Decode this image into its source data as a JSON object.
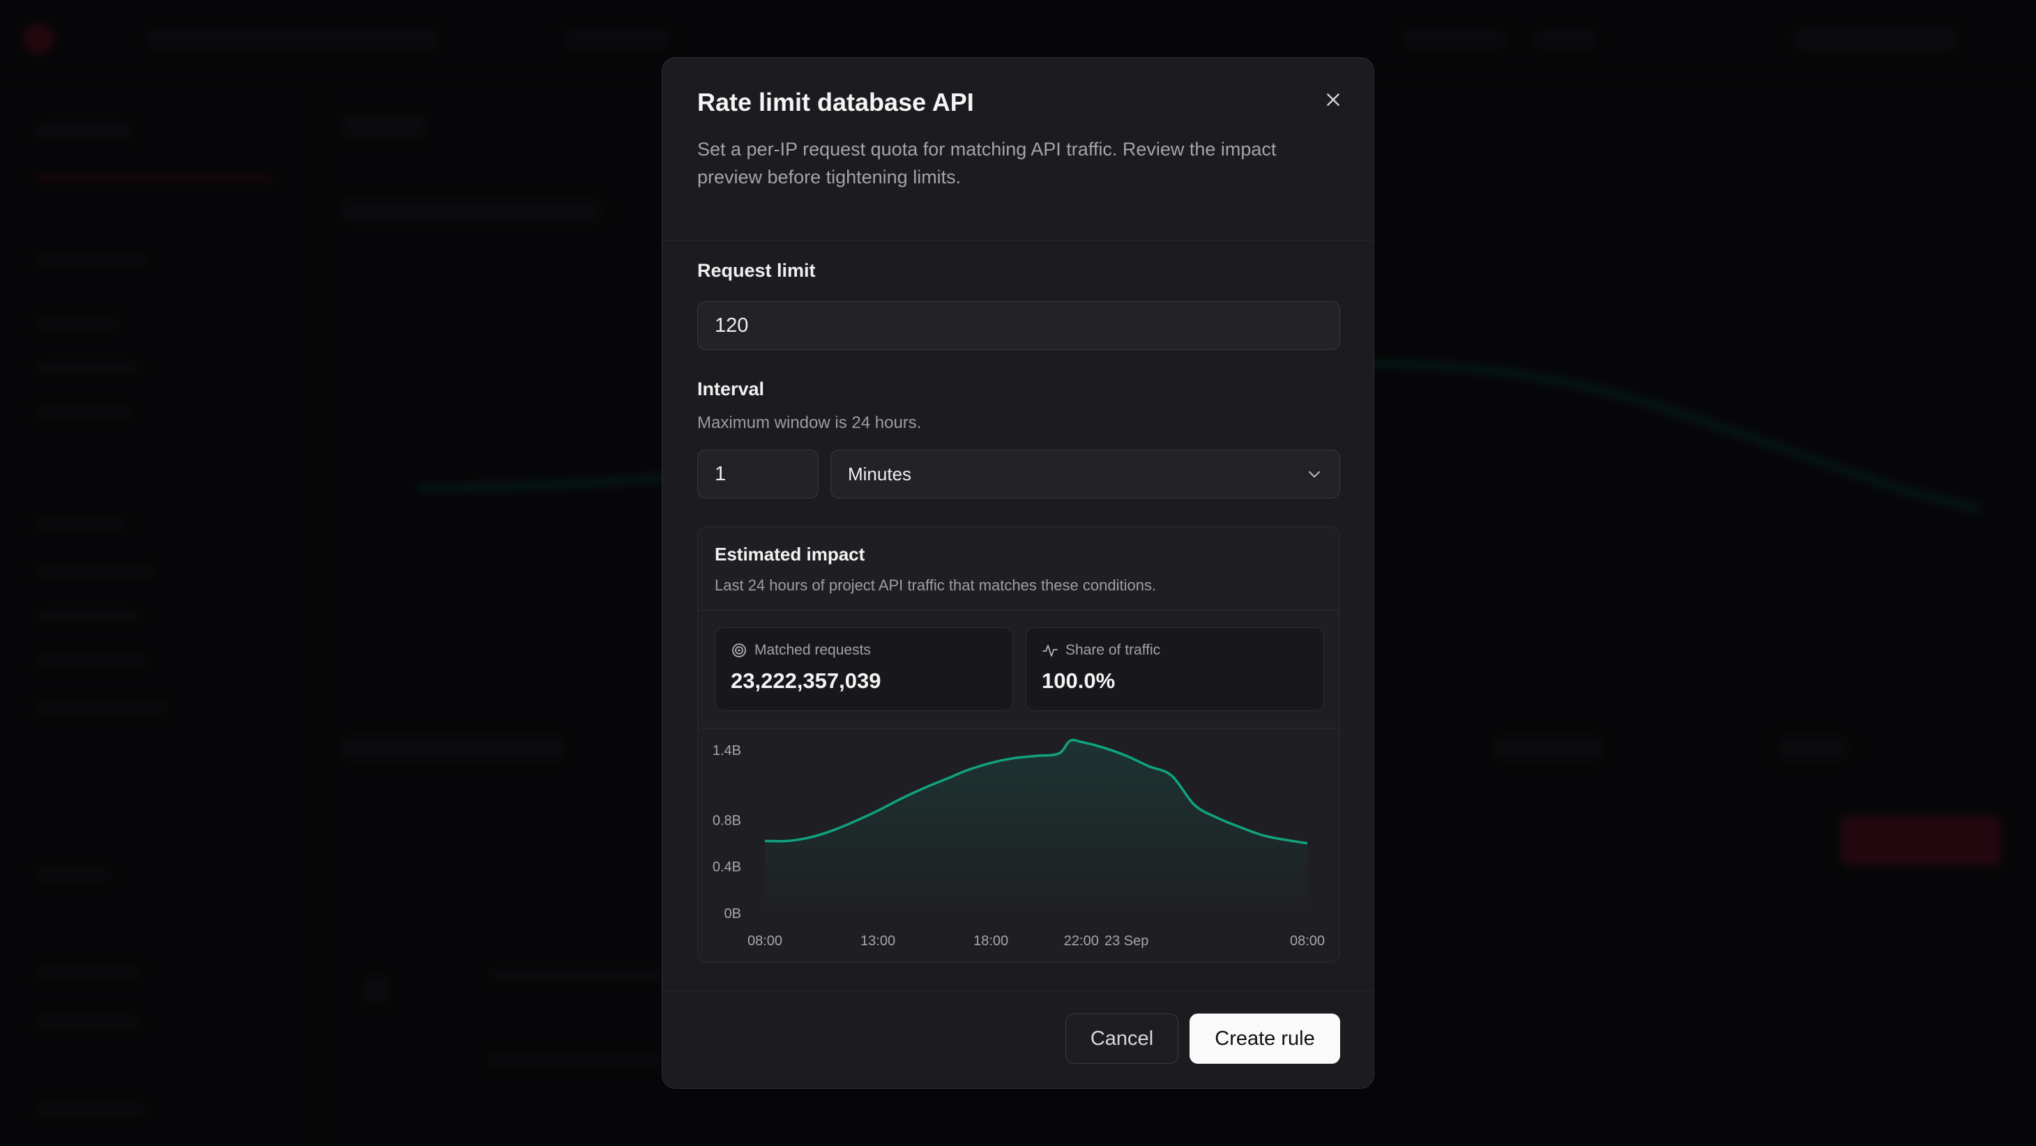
{
  "modal": {
    "title": "Rate limit database API",
    "description": "Set a per-IP request quota for matching API traffic. Review the impact preview before tightening limits.",
    "close_icon": "close-icon"
  },
  "request_limit": {
    "label": "Request limit",
    "value": "120"
  },
  "interval": {
    "label": "Interval",
    "help": "Maximum window is 24 hours.",
    "value": "1",
    "unit_selected": "Minutes"
  },
  "impact": {
    "title": "Estimated impact",
    "subtitle": "Last 24 hours of project API traffic that matches these conditions.",
    "stats": [
      {
        "label": "Matched requests",
        "value": "23,222,357,039",
        "icon": "target-icon"
      },
      {
        "label": "Share of traffic",
        "value": "100.0%",
        "icon": "activity-icon"
      }
    ]
  },
  "chart_data": {
    "type": "area",
    "title": "",
    "xlabel": "",
    "ylabel": "",
    "y_ticks": [
      {
        "label": "1.4B",
        "value": 1.4
      },
      {
        "label": "0.8B",
        "value": 0.8
      },
      {
        "label": "0.4B",
        "value": 0.4
      },
      {
        "label": "0B",
        "value": 0
      }
    ],
    "x_ticks": [
      {
        "label": "08:00",
        "hour": 0
      },
      {
        "label": "13:00",
        "hour": 5
      },
      {
        "label": "18:00",
        "hour": 10
      },
      {
        "label": "22:00",
        "hour": 14
      },
      {
        "label": "23 Sep",
        "hour": 16
      },
      {
        "label": "08:00",
        "hour": 24
      }
    ],
    "ylim": [
      0,
      1.4
    ],
    "xlim": [
      0,
      24
    ],
    "series": [
      {
        "color": "#10a37f",
        "points": [
          [
            0,
            0.62
          ],
          [
            1,
            0.62
          ],
          [
            2,
            0.65
          ],
          [
            3,
            0.71
          ],
          [
            4,
            0.79
          ],
          [
            5,
            0.88
          ],
          [
            6,
            0.98
          ],
          [
            7,
            1.07
          ],
          [
            8,
            1.15
          ],
          [
            9,
            1.23
          ],
          [
            10,
            1.29
          ],
          [
            11,
            1.33
          ],
          [
            12,
            1.35
          ],
          [
            13,
            1.37
          ],
          [
            13.5,
            1.48
          ],
          [
            14,
            1.47
          ],
          [
            15,
            1.42
          ],
          [
            16,
            1.35
          ],
          [
            17,
            1.26
          ],
          [
            18,
            1.18
          ],
          [
            19,
            0.93
          ],
          [
            20,
            0.82
          ],
          [
            21,
            0.74
          ],
          [
            22,
            0.67
          ],
          [
            23,
            0.63
          ],
          [
            24,
            0.6
          ]
        ]
      }
    ]
  },
  "footer": {
    "cancel_label": "Cancel",
    "create_label": "Create rule"
  }
}
